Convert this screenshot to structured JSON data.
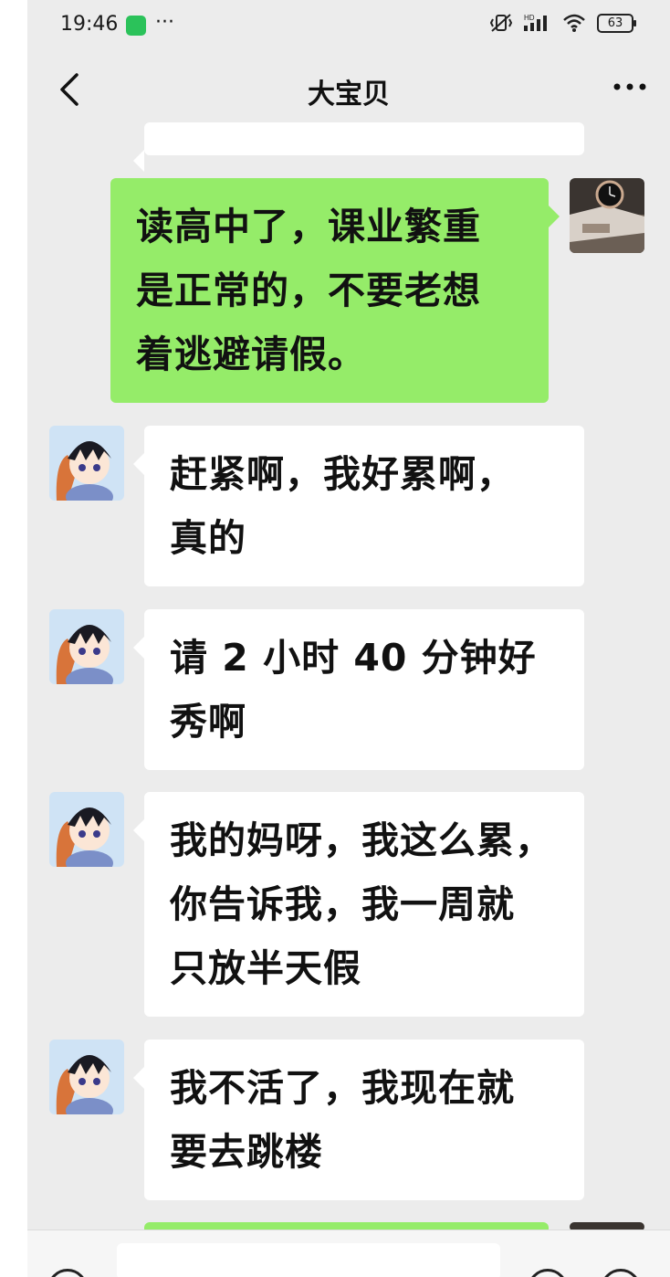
{
  "status_bar": {
    "time": "19:46",
    "dots": "···",
    "battery": "63",
    "network": "HD"
  },
  "header": {
    "title": "大宝贝",
    "back_icon": "chevron-left-icon",
    "more_icon": "more-dots-icon"
  },
  "messages": [
    {
      "side": "out",
      "text": "读高中了，课业繁重\n是正常的，不要老想\n着逃避请假。"
    },
    {
      "side": "in",
      "text": "赶紧啊，我好累啊，\n真的"
    },
    {
      "side": "in",
      "text": "请 2 小时 40 分钟好\n秀啊"
    },
    {
      "side": "in",
      "text": "我的妈呀，我这么累，\n你告诉我，我一周就\n只放半天假"
    },
    {
      "side": "in",
      "text": "我不活了，我现在就\n要去跳楼"
    }
  ],
  "colors": {
    "chat_bg": "#ececec",
    "outgoing_bubble": "#95ec69",
    "incoming_bubble": "#ffffff",
    "status_app_icon": "#2bc25a"
  },
  "input_bar": {
    "voice_icon": "voice-icon",
    "emoji_icon": "emoji-icon",
    "plus_icon": "plus-icon"
  }
}
